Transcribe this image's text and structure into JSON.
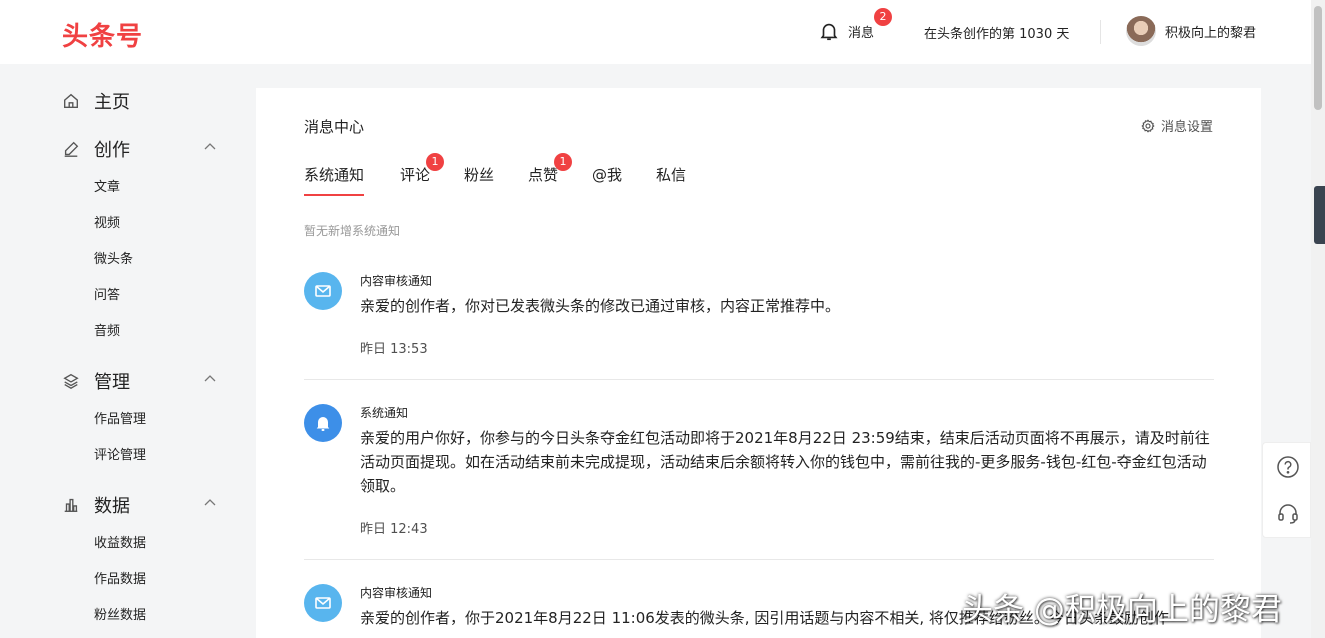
{
  "header": {
    "logo": "头条号",
    "messages_label": "消息",
    "messages_badge": "2",
    "days_text": "在头条创作的第 1030 天",
    "username": "积极向上的黎君"
  },
  "sidebar": {
    "groups": [
      {
        "label": "主页",
        "icon": "home-icon",
        "items": []
      },
      {
        "label": "创作",
        "icon": "pen-icon",
        "items": [
          "文章",
          "视频",
          "微头条",
          "问答",
          "音频"
        ]
      },
      {
        "label": "管理",
        "icon": "layers-icon",
        "items": [
          "作品管理",
          "评论管理"
        ]
      },
      {
        "label": "数据",
        "icon": "chart-icon",
        "items": [
          "收益数据",
          "作品数据",
          "粉丝数据"
        ]
      }
    ]
  },
  "main": {
    "title": "消息中心",
    "settings_label": "消息设置",
    "tabs": [
      {
        "label": "系统通知",
        "badge": ""
      },
      {
        "label": "评论",
        "badge": "1"
      },
      {
        "label": "粉丝",
        "badge": ""
      },
      {
        "label": "点赞",
        "badge": "1"
      },
      {
        "label": "@我",
        "badge": ""
      },
      {
        "label": "私信",
        "badge": ""
      }
    ],
    "active_tab": "系统通知",
    "empty_note": "暂无新增系统通知",
    "notices": [
      {
        "type": "内容审核通知",
        "icon": "mail-icon",
        "body": "亲爱的创作者，你对已发表微头条的修改已通过审核，内容正常推荐中。",
        "time": "昨日 13:53"
      },
      {
        "type": "系统通知",
        "icon": "bell-icon",
        "body": "亲爱的用户你好，你参与的今日头条夺金红包活动即将于2021年8月22日 23:59结束，结束后活动页面将不再展示，请及时前往活动页面提现。如在活动结束前未完成提现，活动结束后余额将转入你的钱包中，需前往我的-更多服务-钱包-红包-夺金红包活动领取。",
        "time": "昨日 12:43"
      },
      {
        "type": "内容审核通知",
        "icon": "mail-icon",
        "body": "亲爱的创作者，你于2021年8月22日 11:06发表的微头条, 因引用话题与内容不相关, 将仅推荐给粉丝。今日头条鼓励创作",
        "time": ""
      }
    ]
  },
  "float_tools": [
    "help-icon",
    "headset-icon"
  ],
  "watermark": "头条 @积极向上的黎君",
  "colors": {
    "brand": "#f04142",
    "mail_icon_bg": "#58b5ee",
    "bell_icon_bg": "#3d8fe8",
    "page_bg": "#f4f5f6"
  }
}
